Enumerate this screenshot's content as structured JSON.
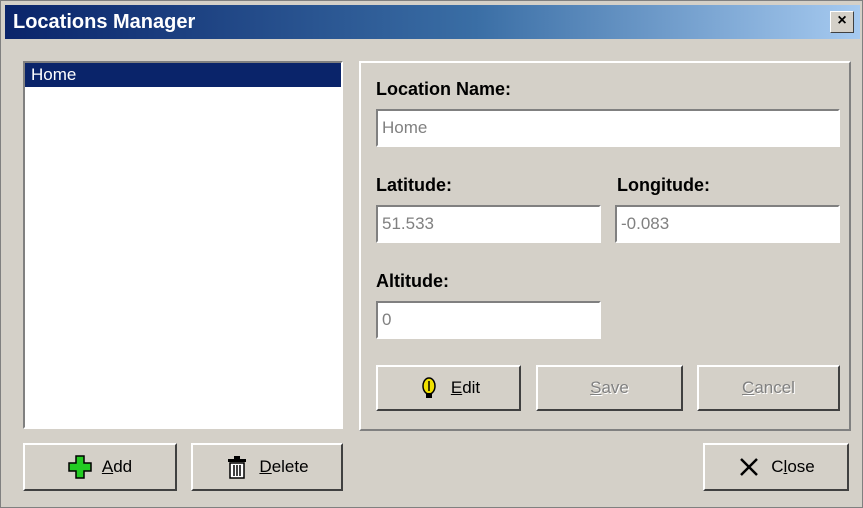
{
  "window": {
    "title": "Locations Manager",
    "close_glyph": "×"
  },
  "locations_list": {
    "items": [
      {
        "label": "Home",
        "selected": true
      }
    ]
  },
  "form": {
    "name_label": "Location Name:",
    "name_value": "Home",
    "latitude_label": "Latitude:",
    "latitude_value": "51.533",
    "longitude_label": "Longitude:",
    "longitude_value": "-0.083",
    "altitude_label": "Altitude:",
    "altitude_value": "0"
  },
  "buttons": {
    "edit": {
      "mnemonic": "E",
      "rest": "dit",
      "icon": "edit-pencil-icon",
      "enabled": true
    },
    "save": {
      "mnemonic": "S",
      "rest": "ave",
      "enabled": false
    },
    "cancel": {
      "mnemonic": "C",
      "rest": "ancel",
      "enabled": false
    },
    "add": {
      "mnemonic": "A",
      "rest": "dd",
      "icon": "plus-icon",
      "enabled": true
    },
    "delete": {
      "mnemonic": "D",
      "rest": "elete",
      "icon": "trash-icon",
      "enabled": true
    },
    "close": {
      "prefix": "C",
      "mnemonic": "l",
      "rest": "ose",
      "icon": "close-x-icon",
      "enabled": true
    }
  },
  "colors": {
    "titlebar_start": "#0a246a",
    "selection": "#0a246a",
    "face": "#d4d0c8"
  }
}
